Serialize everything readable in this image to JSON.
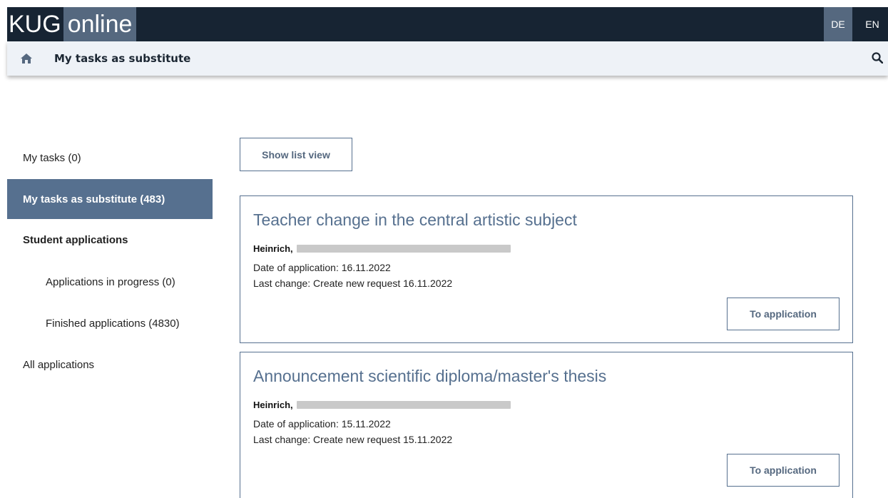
{
  "header": {
    "logo_kug": "KUG",
    "logo_online": "online",
    "lang_de": "DE",
    "lang_en": "EN"
  },
  "subheader": {
    "home_icon": "home-icon",
    "title": "My tasks as substitute",
    "search_icon": "search-icon"
  },
  "sidebar": {
    "my_tasks": "My tasks (0)",
    "my_tasks_substitute": "My tasks as substitute (483)",
    "student_applications": "Student applications",
    "applications_in_progress": "Applications in progress (0)",
    "finished_applications": "Finished applications (4830)",
    "all_applications": "All applications"
  },
  "main": {
    "list_view_button": "Show list view",
    "cards": [
      {
        "title": "Teacher change in the central artistic subject",
        "name_prefix": "Heinrich,",
        "date_of_application": "Date of application: 16.11.2022",
        "last_change": "Last change: Create new request 16.11.2022",
        "button": "To application"
      },
      {
        "title": "Announcement scientific diploma/master's thesis",
        "name_prefix": "Heinrich,",
        "date_of_application": "Date of application: 15.11.2022",
        "last_change": "Last change: Create new request 15.11.2022",
        "button": "To application"
      }
    ]
  },
  "colors": {
    "header_bg": "#172433",
    "accent": "#56708f",
    "subheader_bg": "#eef2f7"
  }
}
